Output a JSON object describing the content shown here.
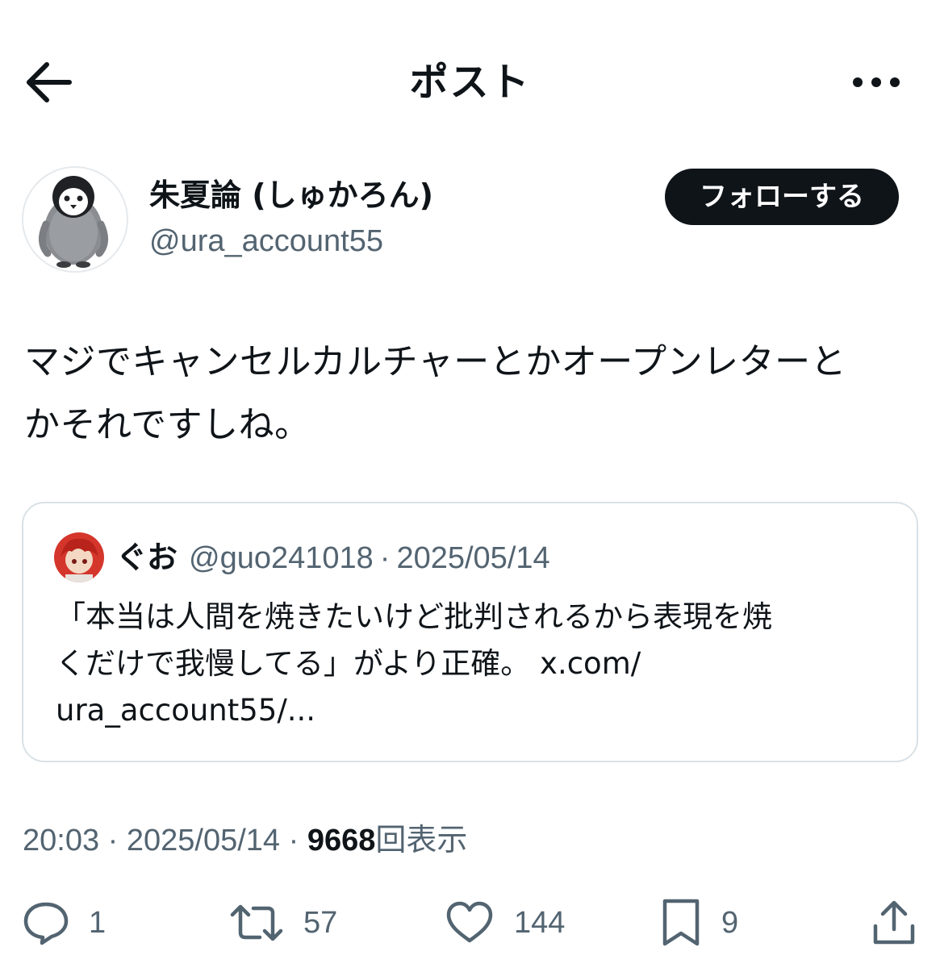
{
  "header": {
    "title": "ポスト"
  },
  "author": {
    "display_name": "朱夏論 (しゅかろん)",
    "handle": "@ura_account55",
    "follow_label": "フォローする"
  },
  "tweet": {
    "text_line1": "マジでキャンセルカルチャーとかオープンレターと",
    "text_line2": "かそれですしね。"
  },
  "quote": {
    "name": "ぐお",
    "handle": "@guo241018",
    "separator": "·",
    "date": "2025/05/14",
    "text_line1": "「本当は人間を焼きたいけど批判されるから表現を焼",
    "text_line2": "くだけで我慢してる」がより正確。 x.com/",
    "text_line3": "ura_account55/..."
  },
  "meta": {
    "time": "20:03",
    "separator": "·",
    "date": "2025/05/14",
    "views_count": "9668",
    "views_label": "回表示"
  },
  "actions": {
    "reply_count": "1",
    "retweet_count": "57",
    "like_count": "144",
    "bookmark_count": "9"
  },
  "icons": {
    "back": "arrow-left-icon",
    "more": "more-horizontal-icon",
    "reply": "reply-icon",
    "retweet": "retweet-icon",
    "like": "heart-icon",
    "bookmark": "bookmark-icon",
    "share": "share-icon"
  },
  "colors": {
    "text": "#0f1419",
    "secondary": "#536471",
    "border": "#d9e1e6",
    "follow_bg": "#0f1419"
  }
}
